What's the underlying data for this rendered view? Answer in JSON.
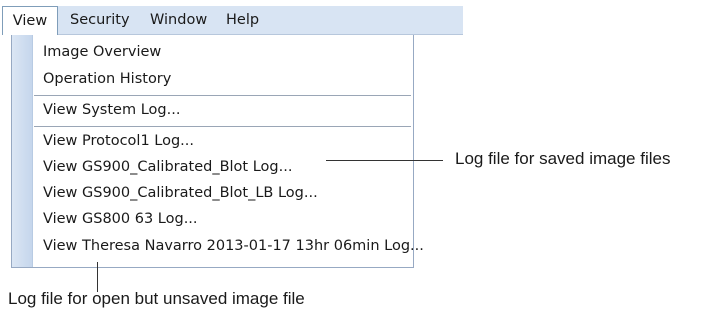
{
  "menubar": {
    "items": [
      {
        "label": "View",
        "active": true
      },
      {
        "label": "Security",
        "active": false
      },
      {
        "label": "Window",
        "active": false
      },
      {
        "label": "Help",
        "active": false
      }
    ]
  },
  "view_menu": {
    "items": [
      {
        "label": "Image Overview"
      },
      {
        "label": "Operation History"
      },
      {
        "label": "View System Log..."
      },
      {
        "label": "View Protocol1 Log..."
      },
      {
        "label": "View GS900_Calibrated_Blot Log..."
      },
      {
        "label": "View GS900_Calibrated_Blot_LB Log..."
      },
      {
        "label": "View GS800 63 Log..."
      },
      {
        "label": "View Theresa Navarro 2013-01-17 13hr 06min Log..."
      }
    ]
  },
  "callouts": {
    "saved": "Log file for saved image files",
    "unsaved": "Log file for open but unsaved image file"
  },
  "colors": {
    "menubar_bg": "#d8e4f3",
    "gutter": "#c5d6ec"
  }
}
